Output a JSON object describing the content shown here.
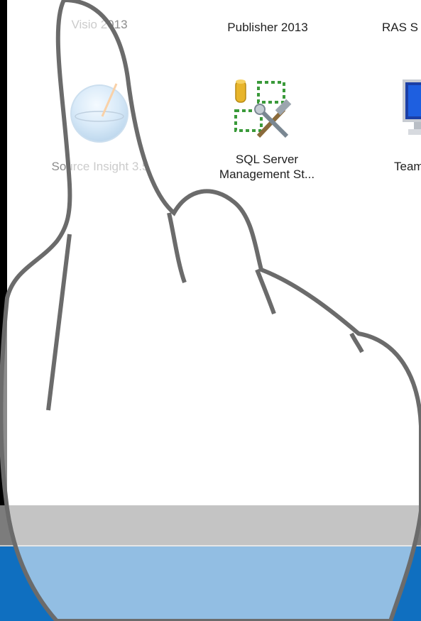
{
  "apps": [
    {
      "label": "Visio 2013",
      "icon": "visio-icon"
    },
    {
      "label": "Publisher 2013",
      "icon": "publisher-icon"
    },
    {
      "label": "RAS S",
      "icon": "ras-icon"
    },
    {
      "label": "Source Insight 3.5",
      "icon": "source-insight-icon"
    },
    {
      "label_line1": "SQL Server",
      "label_line2": "Management St...",
      "icon": "sql-server-management-studio-icon"
    },
    {
      "label": "Team",
      "icon": "team-icon"
    }
  ],
  "colors": {
    "taskbar_blue": "#0f6fc0",
    "overlay_grey": "#7c7c7c",
    "hand_outline": "#6b6b6b"
  }
}
